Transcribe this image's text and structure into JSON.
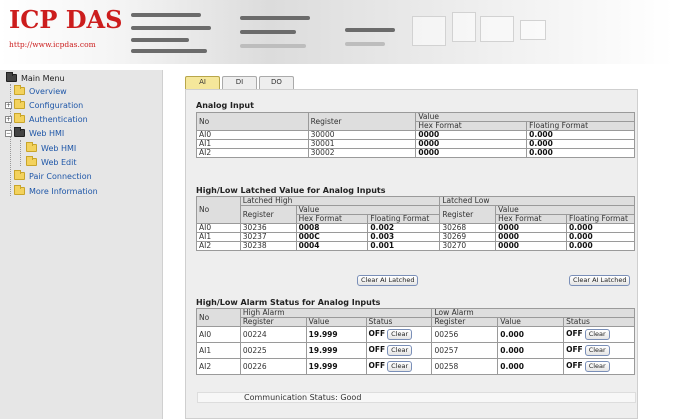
{
  "header": {
    "logo": "ICP DAS",
    "url": "http://www.icpdas.com"
  },
  "sidebar": {
    "root": "Main Menu",
    "items": [
      {
        "label": "Overview",
        "expandable": false
      },
      {
        "label": "Configuration",
        "expandable": true
      },
      {
        "label": "Authentication",
        "expandable": true
      },
      {
        "label": "Web HMI",
        "expandable": true,
        "expanded": true
      },
      {
        "label": "Web HMI",
        "child": true
      },
      {
        "label": "Web Edit",
        "child": true
      },
      {
        "label": "Pair Connection",
        "expandable": false
      },
      {
        "label": "More Information",
        "expandable": false
      }
    ]
  },
  "tabs": [
    {
      "label": "AI",
      "active": true
    },
    {
      "label": "DI",
      "active": false
    },
    {
      "label": "DO",
      "active": false
    }
  ],
  "analog_input": {
    "title": "Analog Input",
    "headers": {
      "no": "No",
      "register": "Register",
      "value": "Value",
      "hex": "Hex Format",
      "float": "Floating Format"
    },
    "rows": [
      {
        "no": "AI0",
        "register": "30000",
        "hex": "0000",
        "float": "0.000"
      },
      {
        "no": "AI1",
        "register": "30001",
        "hex": "0000",
        "float": "0.000"
      },
      {
        "no": "AI2",
        "register": "30002",
        "hex": "0000",
        "float": "0.000"
      }
    ]
  },
  "latched": {
    "title": "High/Low Latched Value for Analog Inputs",
    "headers": {
      "no": "No",
      "latched_high": "Latched High",
      "latched_low": "Latched Low",
      "register": "Register",
      "value": "Value",
      "hex": "Hex Format",
      "float": "Floating Format"
    },
    "rows": [
      {
        "no": "AI0",
        "high_reg": "30236",
        "high_hex": "0008",
        "high_float": "0.002",
        "low_reg": "30268",
        "low_hex": "0000",
        "low_float": "0.000"
      },
      {
        "no": "AI1",
        "high_reg": "30237",
        "high_hex": "000C",
        "high_float": "0.003",
        "low_reg": "30269",
        "low_hex": "0000",
        "low_float": "0.000"
      },
      {
        "no": "AI2",
        "high_reg": "30238",
        "high_hex": "0004",
        "high_float": "0.001",
        "low_reg": "30270",
        "low_hex": "0000",
        "low_float": "0.000"
      }
    ],
    "clear_button": "Clear AI Latched"
  },
  "alarm": {
    "title": "High/Low Alarm Status for Analog Inputs",
    "headers": {
      "no": "No",
      "high_alarm": "High Alarm",
      "low_alarm": "Low Alarm",
      "register": "Register",
      "value": "Value",
      "status": "Status"
    },
    "rows": [
      {
        "no": "AI0",
        "high_reg": "00224",
        "high_value": "19.999",
        "high_status": "OFF",
        "low_reg": "00256",
        "low_value": "0.000",
        "low_status": "OFF"
      },
      {
        "no": "AI1",
        "high_reg": "00225",
        "high_value": "19.999",
        "high_status": "OFF",
        "low_reg": "00257",
        "low_value": "0.000",
        "low_status": "OFF"
      },
      {
        "no": "AI2",
        "high_reg": "00226",
        "high_value": "19.999",
        "high_status": "OFF",
        "low_reg": "00258",
        "low_value": "0.000",
        "low_status": "OFF"
      }
    ],
    "clear_label": "Clear"
  },
  "status": {
    "text": "Communication Status: Good"
  }
}
